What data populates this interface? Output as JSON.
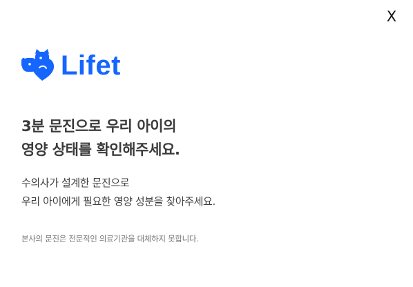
{
  "dialog": {
    "close_label": "X"
  },
  "brand": {
    "name": "Lifet",
    "color": "#1565ff",
    "logo_icon": "dog-cat-heart-logo"
  },
  "headline": {
    "line1": "3분 문진으로 우리 아이의",
    "line2": "영양 상태를 확인해주세요."
  },
  "description": {
    "line1": "수의사가 설계한 문진으로",
    "line2": "우리 아이에게 필요한 영양 성분을 찾아주세요."
  },
  "disclaimer": "본사의 문진은 전문적인 의료기관을 대체하지 못합니다."
}
